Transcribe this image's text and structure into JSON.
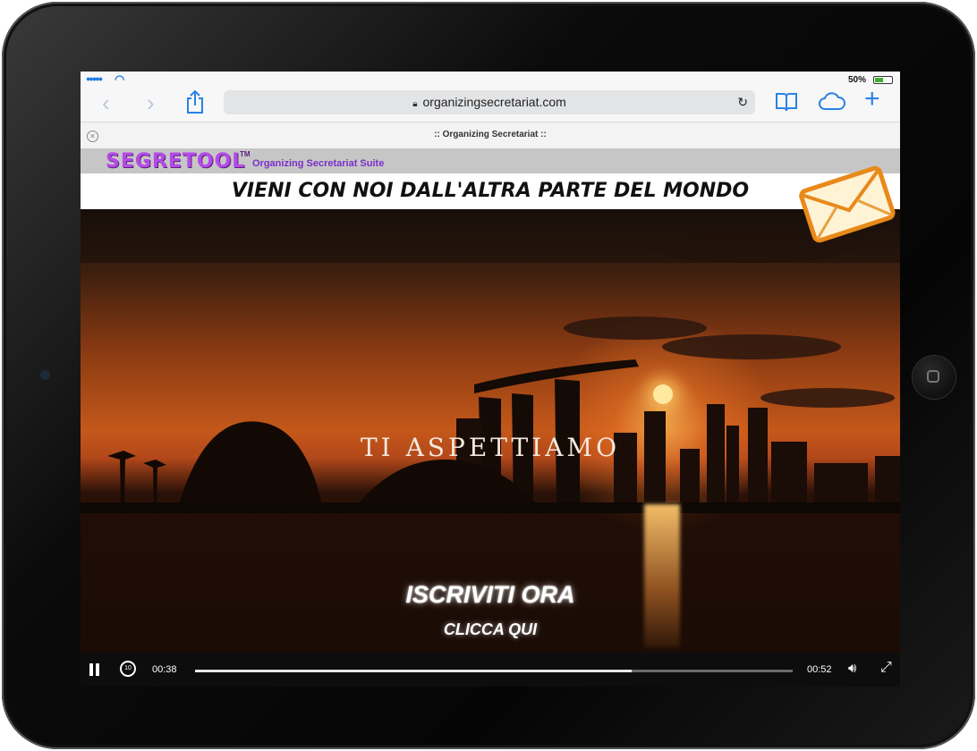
{
  "status_bar": {
    "battery_percent": "50%",
    "battery_level": 0.5
  },
  "browser": {
    "url": "organizingsecretariat.com",
    "tab_title": ":: Organizing Secretariat ::"
  },
  "site": {
    "logo_text": "SEGRETOOL",
    "logo_tm": "TM",
    "suite_text": "Organizing Secretariat Suite",
    "banner_text": "VIENI CON NOI DALL'ALTRA PARTE DEL MONDO"
  },
  "video": {
    "overlay_title": "TI ASPETTIAMO",
    "cta_primary": "ISCRIVITI ORA",
    "cta_secondary": "CLICCA QUI",
    "current_time": "00:38",
    "duration": "00:52",
    "progress": 0.73,
    "rewind_seconds": "10"
  },
  "colors": {
    "accent": "#2a82e4",
    "logo": "#b54ae8",
    "mail": "#f5a623"
  }
}
